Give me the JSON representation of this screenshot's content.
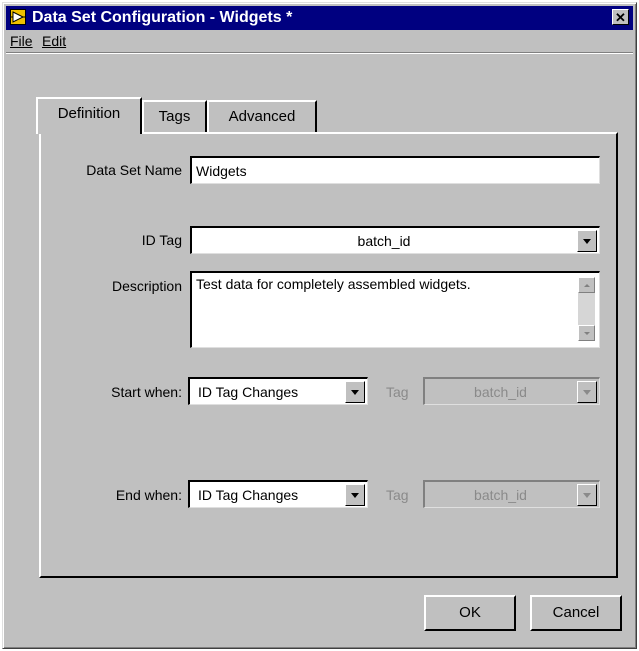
{
  "window": {
    "title": "Data Set Configuration - Widgets *"
  },
  "menu": {
    "file_label": "File",
    "edit_label": "Edit"
  },
  "tabs": [
    {
      "label": "Definition",
      "active": true
    },
    {
      "label": "Tags",
      "active": false
    },
    {
      "label": "Advanced",
      "active": false
    }
  ],
  "form": {
    "dataset_name_label": "Data Set Name",
    "dataset_name_value": "Widgets",
    "id_tag_label": "ID Tag",
    "id_tag_value": "batch_id",
    "description_label": "Description",
    "description_value": "Test data for completely assembled widgets.",
    "start_when_label": "Start when:",
    "start_when_value": "ID Tag Changes",
    "start_tag_label": "Tag",
    "start_tag_value": "batch_id",
    "end_when_label": "End when:",
    "end_when_value": "ID Tag Changes",
    "end_tag_label": "Tag",
    "end_tag_value": "batch_id"
  },
  "buttons": {
    "ok_label": "OK",
    "cancel_label": "Cancel"
  },
  "icons": {
    "app_icon": "labview-icon",
    "close": "close-icon",
    "dropdown": "chevron-down-icon"
  },
  "colors": {
    "titlebar": "#000080",
    "face": "#c0c0c0",
    "disabled_text": "#8a8a8a"
  }
}
